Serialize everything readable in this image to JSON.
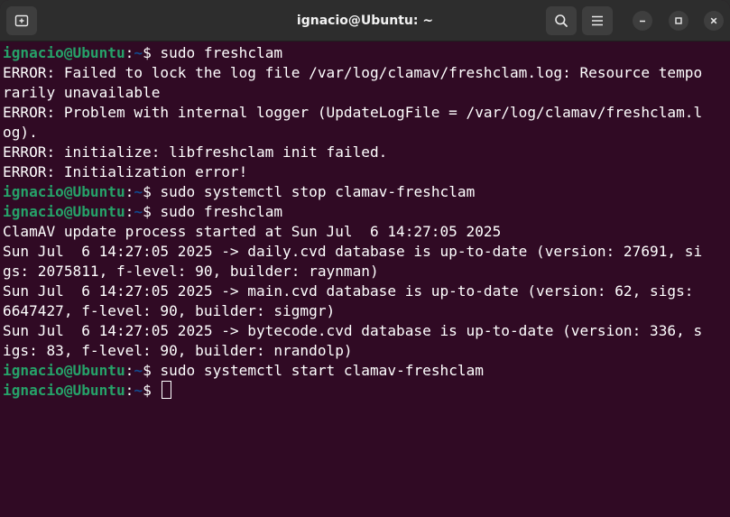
{
  "window": {
    "title": "ignacio@Ubuntu: ~"
  },
  "prompt": {
    "user_host": "ignacio@Ubuntu",
    "separator": ":",
    "path": "~",
    "symbol": "$ "
  },
  "terminal": {
    "lines": [
      {
        "type": "prompt",
        "command": "sudo freshclam"
      },
      {
        "type": "output",
        "text": "ERROR: Failed to lock the log file /var/log/clamav/freshclam.log: Resource tempo"
      },
      {
        "type": "output",
        "text": "rarily unavailable"
      },
      {
        "type": "output",
        "text": "ERROR: Problem with internal logger (UpdateLogFile = /var/log/clamav/freshclam.l"
      },
      {
        "type": "output",
        "text": "og)."
      },
      {
        "type": "output",
        "text": "ERROR: initialize: libfreshclam init failed."
      },
      {
        "type": "output",
        "text": "ERROR: Initialization error!"
      },
      {
        "type": "prompt",
        "command": "sudo systemctl stop clamav-freshclam"
      },
      {
        "type": "prompt",
        "command": "sudo freshclam"
      },
      {
        "type": "output",
        "text": "ClamAV update process started at Sun Jul  6 14:27:05 2025"
      },
      {
        "type": "output",
        "text": "Sun Jul  6 14:27:05 2025 -> daily.cvd database is up-to-date (version: 27691, si"
      },
      {
        "type": "output",
        "text": "gs: 2075811, f-level: 90, builder: raynman)"
      },
      {
        "type": "output",
        "text": "Sun Jul  6 14:27:05 2025 -> main.cvd database is up-to-date (version: 62, sigs:"
      },
      {
        "type": "output",
        "text": "6647427, f-level: 90, builder: sigmgr)"
      },
      {
        "type": "output",
        "text": "Sun Jul  6 14:27:05 2025 -> bytecode.cvd database is up-to-date (version: 336, s"
      },
      {
        "type": "output",
        "text": "igs: 83, f-level: 90, builder: nrandolp)"
      },
      {
        "type": "prompt",
        "command": "sudo systemctl start clamav-freshclam"
      },
      {
        "type": "prompt",
        "command": "",
        "cursor": true
      }
    ]
  },
  "colors": {
    "background": "#300a24",
    "titlebar": "#2d2d2d",
    "user_host": "#26a269",
    "path": "#12488b",
    "text": "#ffffff"
  },
  "icons": {
    "new_tab": "new-tab-icon",
    "search": "search-icon",
    "menu": "hamburger-menu-icon",
    "minimize": "minimize-icon",
    "maximize": "maximize-icon",
    "close": "close-icon"
  }
}
